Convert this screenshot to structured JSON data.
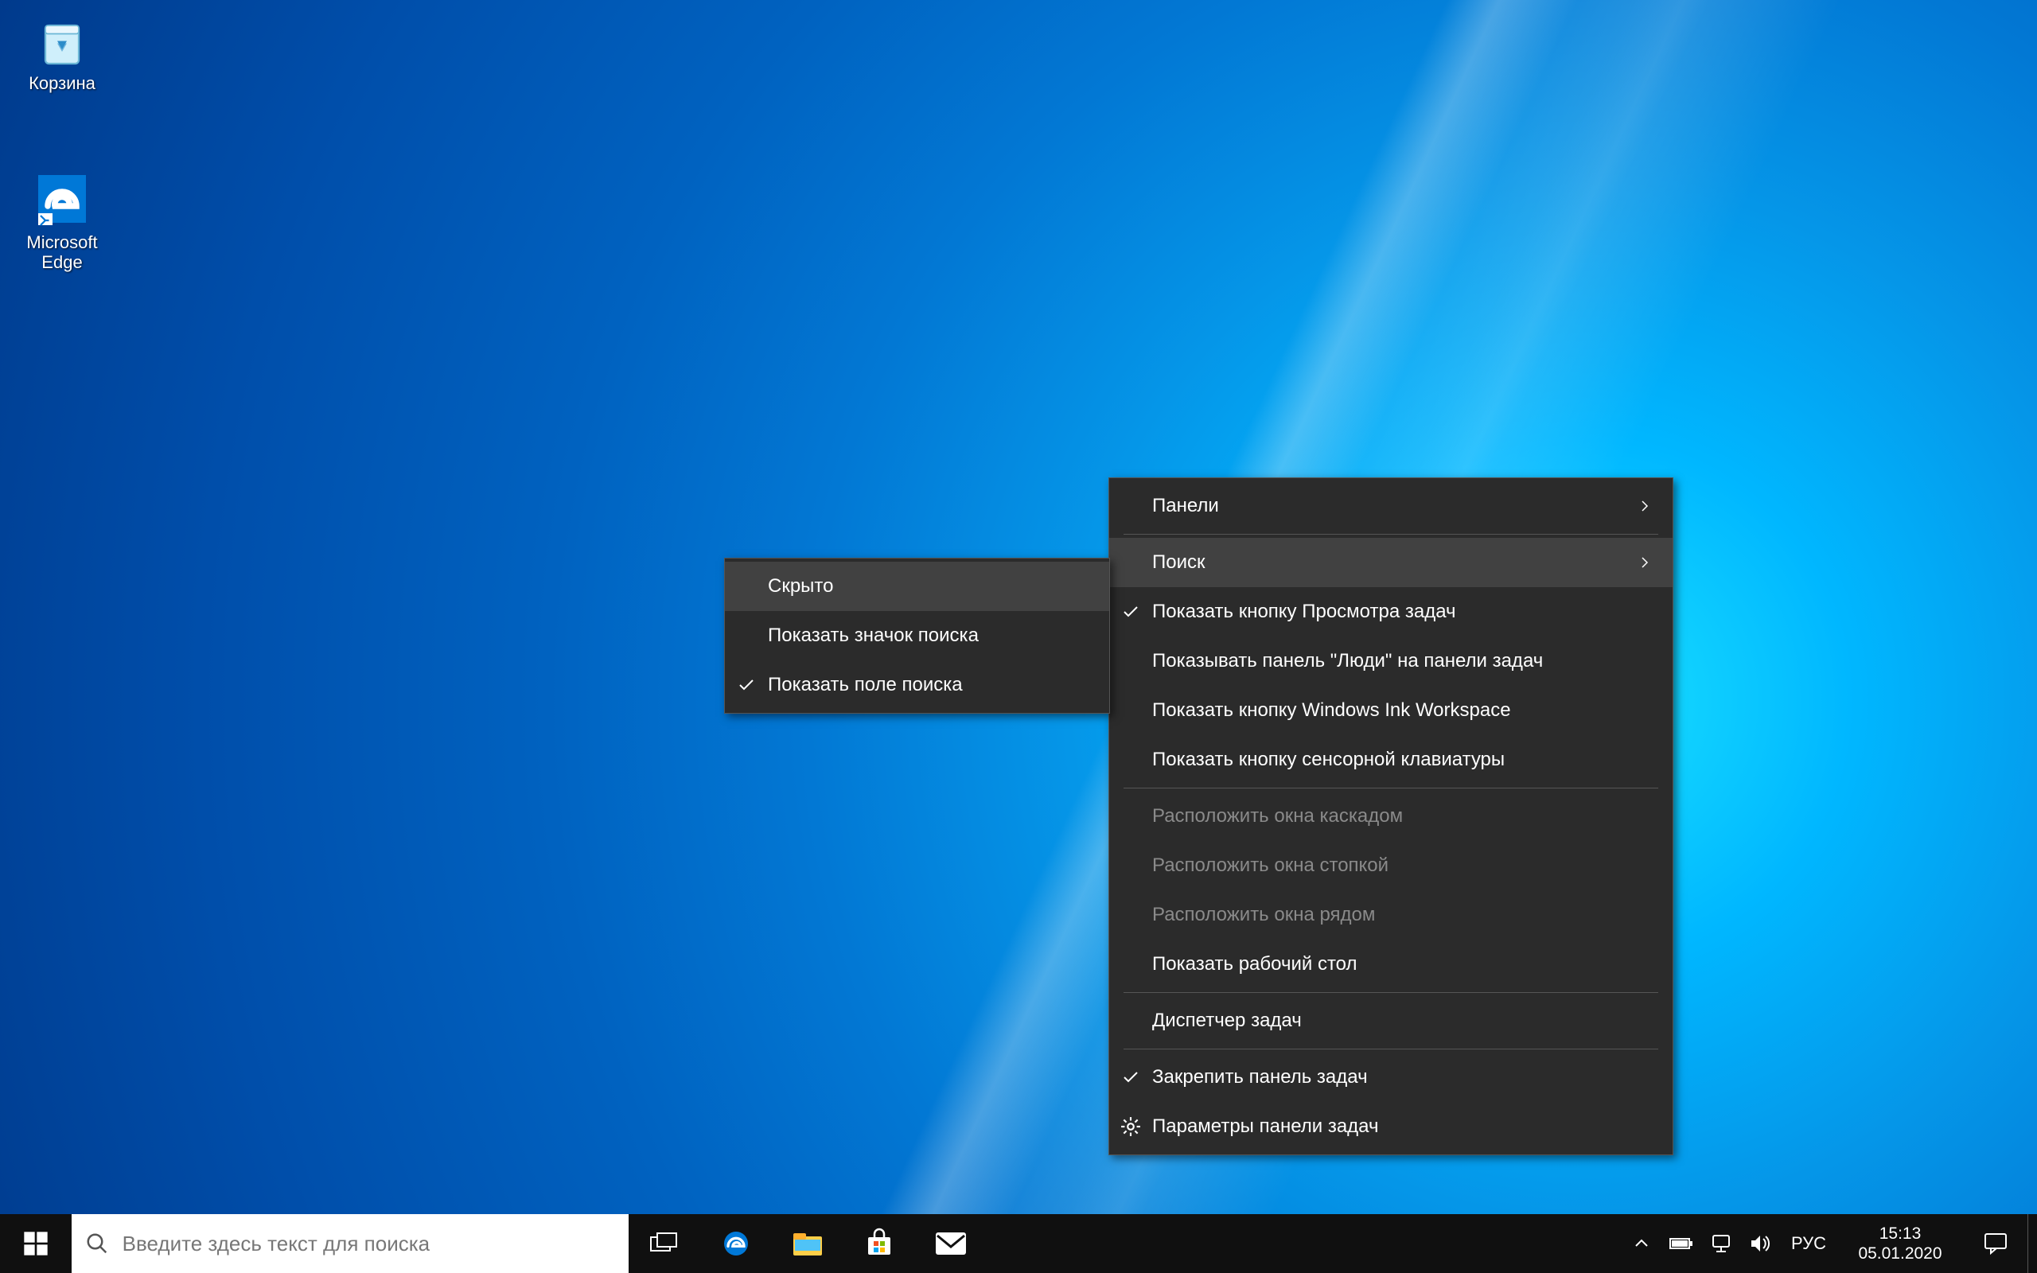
{
  "desktop": {
    "icons": [
      {
        "name": "recycle-bin",
        "label": "Корзина"
      },
      {
        "name": "edge",
        "label": "Microsoft\nEdge"
      }
    ]
  },
  "taskbar": {
    "search_placeholder": "Введите здесь текст для поиска",
    "language": "РУС",
    "time": "15:13",
    "date": "05.01.2020"
  },
  "context_menu": {
    "items": [
      {
        "label": "Панели",
        "submenu": true
      },
      {
        "sep": true
      },
      {
        "label": "Поиск",
        "submenu": true,
        "highlight": true
      },
      {
        "label": "Показать кнопку Просмотра задач",
        "checked": true
      },
      {
        "label": "Показывать панель \"Люди\" на панели задач"
      },
      {
        "label": "Показать кнопку Windows Ink Workspace"
      },
      {
        "label": "Показать кнопку сенсорной клавиатуры"
      },
      {
        "sep": true
      },
      {
        "label": "Расположить окна каскадом",
        "disabled": true
      },
      {
        "label": "Расположить окна стопкой",
        "disabled": true
      },
      {
        "label": "Расположить окна рядом",
        "disabled": true
      },
      {
        "label": "Показать рабочий стол"
      },
      {
        "sep": true
      },
      {
        "label": "Диспетчер задач"
      },
      {
        "sep": true
      },
      {
        "label": "Закрепить панель задач",
        "checked": true
      },
      {
        "label": "Параметры панели задач",
        "icon": "gear"
      }
    ]
  },
  "search_submenu": {
    "items": [
      {
        "label": "Скрыто",
        "highlight": true
      },
      {
        "label": "Показать значок поиска"
      },
      {
        "label": "Показать поле поиска",
        "checked": true
      }
    ]
  }
}
